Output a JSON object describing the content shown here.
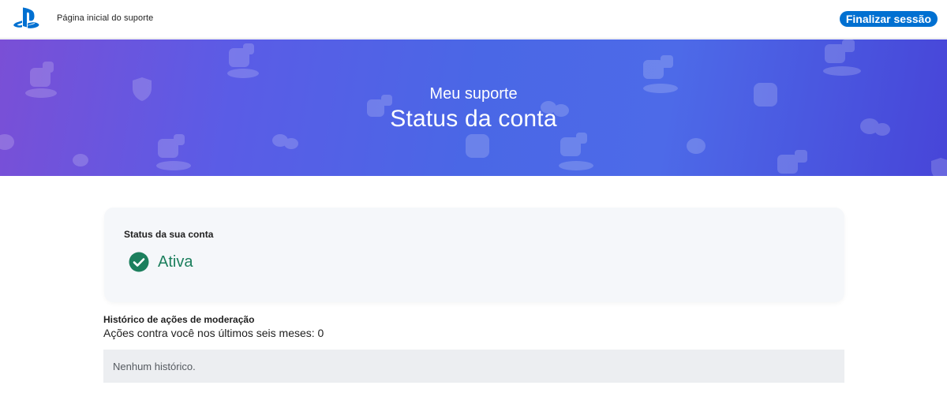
{
  "header": {
    "home_link": "Página inicial do suporte",
    "signout_label": "Finalizar sessão",
    "logo_icon": "playstation-logo-icon"
  },
  "hero": {
    "eyebrow": "Meu suporte",
    "title": "Status da conta"
  },
  "status_card": {
    "label": "Status da sua conta",
    "value": "Ativa",
    "icon": "check-circle-icon",
    "color": "#1c7f5d"
  },
  "moderation": {
    "title": "Histórico de ações de moderação",
    "count_text": "Ações contra você nos últimos seis meses: 0",
    "empty_text": "Nenhum histórico."
  },
  "colors": {
    "accent": "#0070d1",
    "success": "#1c7f5d"
  }
}
